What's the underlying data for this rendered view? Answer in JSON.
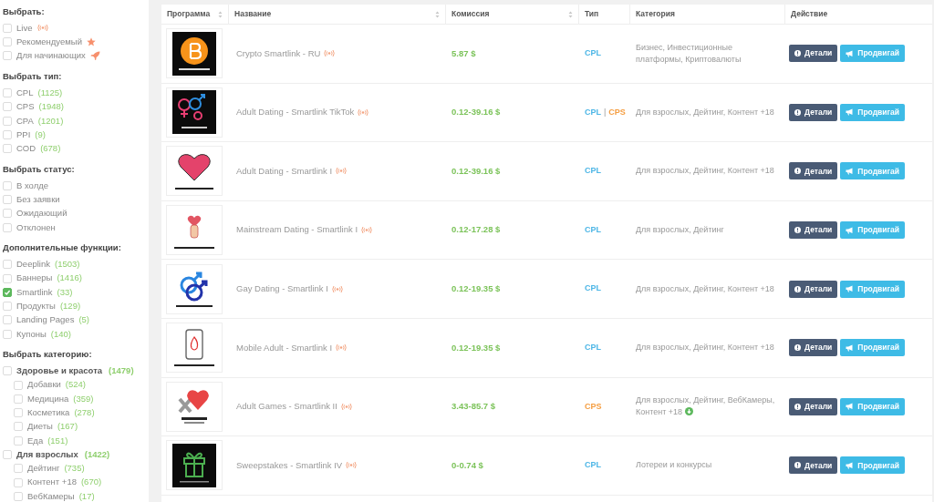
{
  "filters": [
    {
      "title": "Выбрать:",
      "items": [
        {
          "label": "Live",
          "kind": "live",
          "checked": false
        },
        {
          "label": "Рекомендуемый",
          "kind": "featured",
          "checked": false
        },
        {
          "label": "Для начинающих",
          "kind": "beginner",
          "checked": false
        }
      ]
    },
    {
      "title": "Выбрать тип:",
      "items": [
        {
          "label": "CPL",
          "count": "(1125)",
          "checked": false
        },
        {
          "label": "CPS",
          "count": "(1948)",
          "checked": false
        },
        {
          "label": "CPA",
          "count": "(1201)",
          "checked": false
        },
        {
          "label": "PPI",
          "count": "(9)",
          "checked": false
        },
        {
          "label": "COD",
          "count": "(678)",
          "checked": false
        }
      ]
    },
    {
      "title": "Выбрать статус:",
      "items": [
        {
          "label": "В холде",
          "checked": false
        },
        {
          "label": "Без заявки",
          "checked": false
        },
        {
          "label": "Ожидающий",
          "checked": false
        },
        {
          "label": "Отклонен",
          "checked": false
        }
      ]
    },
    {
      "title": "Дополнительные функции:",
      "items": [
        {
          "label": "Deeplink",
          "count": "(1503)",
          "checked": false
        },
        {
          "label": "Баннеры",
          "count": "(1416)",
          "checked": false
        },
        {
          "label": "Smartlink",
          "count": "(33)",
          "checked": true
        },
        {
          "label": "Продукты",
          "count": "(129)",
          "checked": false
        },
        {
          "label": "Landing Pages",
          "count": "(5)",
          "checked": false
        },
        {
          "label": "Купоны",
          "count": "(140)",
          "checked": false
        }
      ]
    },
    {
      "title": "Выбрать категорию:",
      "items": [
        {
          "label": "Здоровье и красота",
          "count": "(1479)",
          "checked": false,
          "children": [
            {
              "label": "Добавки",
              "count": "(524)",
              "checked": false
            },
            {
              "label": "Медицина",
              "count": "(359)",
              "checked": false
            },
            {
              "label": "Косметика",
              "count": "(278)",
              "checked": false
            },
            {
              "label": "Диеты",
              "count": "(167)",
              "checked": false
            },
            {
              "label": "Еда",
              "count": "(151)",
              "checked": false
            }
          ]
        },
        {
          "label": "Для взрослых",
          "count": "(1422)",
          "checked": false,
          "children": [
            {
              "label": "Дейтинг",
              "count": "(735)",
              "checked": false
            },
            {
              "label": "Контент +18",
              "count": "(670)",
              "checked": false
            },
            {
              "label": "ВебКамеры",
              "count": "(17)",
              "checked": false
            }
          ]
        }
      ]
    }
  ],
  "table": {
    "columns": [
      {
        "label": "Программа",
        "sortable": true
      },
      {
        "label": "Название",
        "sortable": true
      },
      {
        "label": "Комиссия",
        "sortable": true
      },
      {
        "label": "Тип",
        "sortable": false
      },
      {
        "label": "Категория",
        "sortable": false
      },
      {
        "label": "Действие",
        "sortable": false
      }
    ],
    "type_separator": "|",
    "rows": [
      {
        "kind": "crypto",
        "name": "Crypto Smartlink - RU",
        "live": true,
        "commission": "5.87 $",
        "types": [
          {
            "label": "CPL",
            "color": "#4db6e6"
          }
        ],
        "category": "Бизнес, Инвестиционные платформы, Криптовалюты",
        "category_icon": false,
        "actions": [
          "Детали",
          "Продвигай"
        ]
      },
      {
        "kind": "dating",
        "name": "Adult Dating - Smartlink TikTok",
        "live": true,
        "commission": "0.12-39.16 $",
        "types": [
          {
            "label": "CPL",
            "color": "#4db6e6"
          },
          {
            "label": "CPS",
            "color": "#f59e42"
          }
        ],
        "category": "Для взрослых, Дейтинг, Контент +18",
        "category_icon": false,
        "actions": [
          "Детали",
          "Продвигай"
        ]
      },
      {
        "kind": "heart",
        "name": "Adult Dating - Smartlink I",
        "live": true,
        "commission": "0.12-39.16 $",
        "types": [
          {
            "label": "CPL",
            "color": "#4db6e6"
          }
        ],
        "category": "Для взрослых, Дейтинг, Контент +18",
        "category_icon": false,
        "actions": [
          "Детали",
          "Продвигай"
        ]
      },
      {
        "kind": "tap",
        "name": "Mainstream Dating - Smartlink I",
        "live": true,
        "commission": "0.12-17.28 $",
        "types": [
          {
            "label": "CPL",
            "color": "#4db6e6"
          }
        ],
        "category": "Для взрослых, Дейтинг",
        "category_icon": false,
        "actions": [
          "Детали",
          "Продвигай"
        ]
      },
      {
        "kind": "gay",
        "name": "Gay Dating - Smartlink I",
        "live": true,
        "commission": "0.12-19.35 $",
        "types": [
          {
            "label": "CPL",
            "color": "#4db6e6"
          }
        ],
        "category": "Для взрослых, Дейтинг, Контент +18",
        "category_icon": false,
        "actions": [
          "Детали",
          "Продвигай"
        ]
      },
      {
        "kind": "mobile",
        "name": "Mobile Adult - Smartlink I",
        "live": true,
        "commission": "0.12-19.35 $",
        "types": [
          {
            "label": "CPL",
            "color": "#4db6e6"
          }
        ],
        "category": "Для взрослых, Дейтинг, Контент +18",
        "category_icon": false,
        "actions": [
          "Детали",
          "Продвигай"
        ]
      },
      {
        "kind": "games",
        "name": "Adult Games - Smartlink II",
        "live": true,
        "commission": "3.43-85.7 $",
        "types": [
          {
            "label": "CPS",
            "color": "#f59e42"
          }
        ],
        "category": "Для взрослых, Дейтинг, ВебКамеры, Контент +18",
        "category_icon": true,
        "actions": [
          "Детали",
          "Продвигай"
        ]
      },
      {
        "kind": "gift",
        "name": "Sweepstakes - Smartlink IV",
        "live": true,
        "commission": "0-0.74 $",
        "types": [
          {
            "label": "CPL",
            "color": "#4db6e6"
          }
        ],
        "category": "Лотереи и конкурсы",
        "category_icon": false,
        "actions": [
          "Детали",
          "Продвигай"
        ]
      }
    ]
  }
}
